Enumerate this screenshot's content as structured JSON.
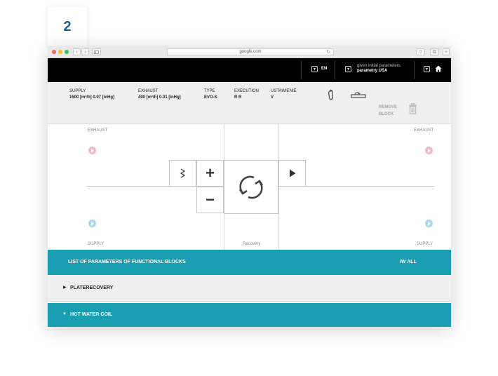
{
  "step": {
    "number": "2"
  },
  "browser": {
    "url": "google.com"
  },
  "header": {
    "language": "EN",
    "params_caption": "given initial parameters",
    "params_value": "parametry USA"
  },
  "params": {
    "supply": {
      "label": "SUPPLY",
      "value": "1500 [m³/h]    0.07 [inHg]"
    },
    "exhaust": {
      "label": "EXHAUST",
      "value": "400 [m³/h]    0.01 [inHg]"
    },
    "type": {
      "label": "TYPE",
      "value": "EVO-S"
    },
    "execution": {
      "label": "EXECUTION",
      "value": "R R"
    },
    "ustawienie": {
      "label": "USTAWIENIE",
      "value": "V"
    },
    "remove_block": "REMOVE BLOCK"
  },
  "canvas": {
    "exhaust_left": "EXHAUST",
    "exhaust_right": "EXHAUST",
    "supply_left": "SUPPLY",
    "supply_right": "SUPPLY",
    "center_label": "Recovery",
    "plus": "+",
    "minus": "−"
  },
  "colors": {
    "exhaust_arrow": "#f0b8cf",
    "supply_arrow": "#a9dbe7",
    "teal": "#1a9eb1"
  },
  "sections": {
    "list_title": "LIST OF PARAMETERS OF FUNCTIONAL BLOCKS",
    "view_all": "IW ALL",
    "plate_recovery": "PLATERECOVERY",
    "hot_water_coil": "HOT WATER COIL"
  }
}
